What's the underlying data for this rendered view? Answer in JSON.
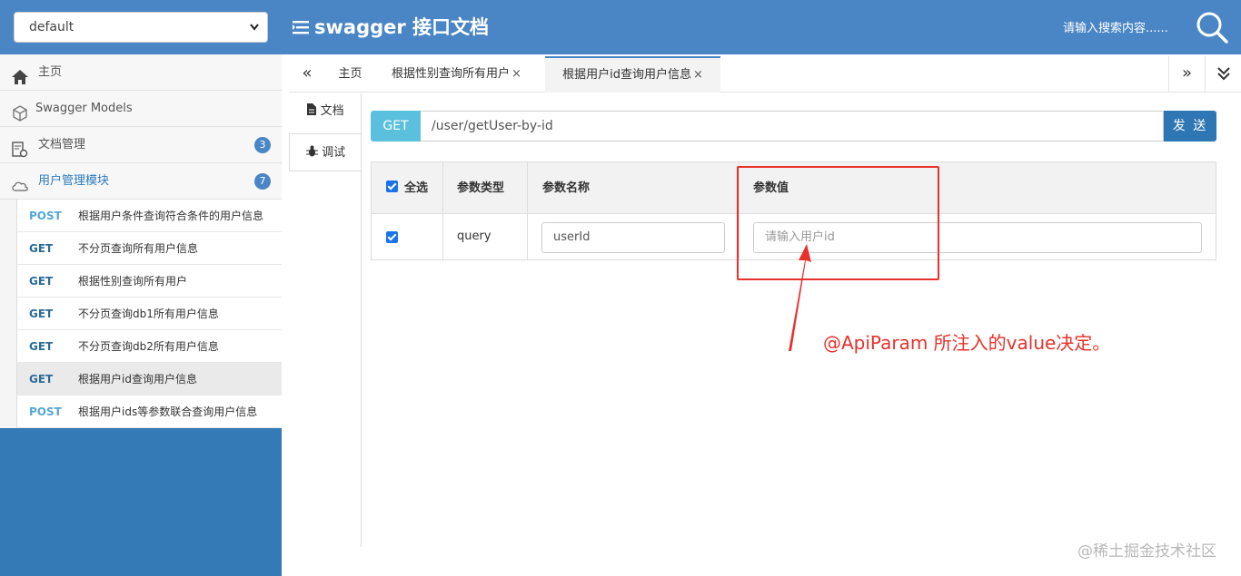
{
  "header": {
    "group_select_value": "default",
    "brand_title": "swagger 接口文档",
    "search_placeholder": "请输入搜索内容......"
  },
  "sidebar": {
    "items": [
      {
        "label": "主页",
        "icon": "home-icon"
      },
      {
        "label": "Swagger Models",
        "icon": "cube-icon"
      },
      {
        "label": "文档管理",
        "icon": "doc-settings-icon",
        "badge": "3"
      },
      {
        "label": "用户管理模块",
        "icon": "cloud-icon",
        "badge": "7"
      }
    ],
    "apis": [
      {
        "method": "POST",
        "label": "根据用户条件查询符合条件的用户信息"
      },
      {
        "method": "GET",
        "label": "不分页查询所有用户信息"
      },
      {
        "method": "GET",
        "label": "根据性别查询所有用户"
      },
      {
        "method": "GET",
        "label": "不分页查询db1所有用户信息"
      },
      {
        "method": "GET",
        "label": "不分页查询db2所有用户信息"
      },
      {
        "method": "GET",
        "label": "根据用户id查询用户信息"
      },
      {
        "method": "POST",
        "label": "根据用户ids等参数联合查询用户信息"
      }
    ]
  },
  "tabs": {
    "prev": "«",
    "next": "»",
    "items": [
      {
        "label": "主页"
      },
      {
        "label": "根据性别查询所有用户",
        "close": "×"
      },
      {
        "label": "根据用户id查询用户信息",
        "close": "×"
      }
    ]
  },
  "side_tabs": {
    "doc": "文档",
    "debug": "调试"
  },
  "request": {
    "method": "GET",
    "url": "/user/getUser-by-id",
    "send_label": "发 送"
  },
  "params": {
    "headers": {
      "select_all": "全选",
      "type": "参数类型",
      "name": "参数名称",
      "value": "参数值"
    },
    "rows": [
      {
        "type": "query",
        "name": "userId",
        "value_placeholder": "请输入用户id"
      }
    ]
  },
  "annotation": {
    "text": "@ApiParam 所注入的value决定。",
    "color": "#e8312b"
  },
  "watermark": "@稀土掘金技术社区",
  "colors": {
    "header_bg": "#4a86c5",
    "get_badge": "#5bc0de",
    "send_btn": "#2f76b5"
  }
}
